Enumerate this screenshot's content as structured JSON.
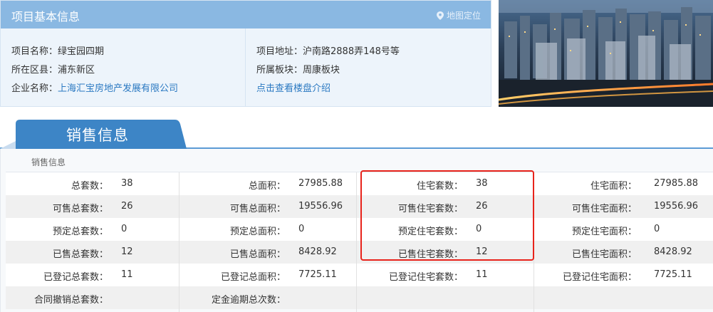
{
  "project": {
    "title": "项目基本信息",
    "map_link": "地图定位",
    "name_label": "项目名称：",
    "name_value": "绿宝园四期",
    "district_label": "所在区县：",
    "district_value": "浦东新区",
    "company_label": "企业名称：",
    "company_value": "上海汇宝房地产发展有限公司",
    "address_label": "项目地址：",
    "address_value": "沪南路2888弄148号等",
    "block_label": "所属板块：",
    "block_value": "周康板块",
    "intro_link": "点击查看楼盘介绍"
  },
  "sales": {
    "tab_label": "销售信息",
    "sub_title": "销售信息",
    "rows": [
      [
        "总套数：",
        "38",
        "总面积：",
        "27985.88",
        "住宅套数：",
        "38",
        "住宅面积：",
        "27985.88"
      ],
      [
        "可售总套数：",
        "26",
        "可售总面积：",
        "19556.96",
        "可售住宅套数：",
        "26",
        "可售住宅面积：",
        "19556.96"
      ],
      [
        "预定总套数：",
        "0",
        "预定总面积：",
        "0",
        "预定住宅套数：",
        "0",
        "预定住宅面积：",
        "0"
      ],
      [
        "已售总套数：",
        "12",
        "已售总面积：",
        "8428.92",
        "已售住宅套数：",
        "12",
        "已售住宅面积：",
        "8428.92"
      ],
      [
        "已登记总套数：",
        "11",
        "已登记总面积：",
        "7725.11",
        "已登记住宅套数：",
        "11",
        "已登记住宅面积：",
        "7725.11"
      ],
      [
        "合同撤销总套数：",
        "",
        "定金逾期总次数：",
        "",
        "",
        "",
        "",
        ""
      ]
    ]
  },
  "colors": {
    "header_blue": "#8ab8e2",
    "tab_blue": "#3d85c6",
    "link_blue": "#2b79c2",
    "highlight_red": "#e8231b"
  }
}
